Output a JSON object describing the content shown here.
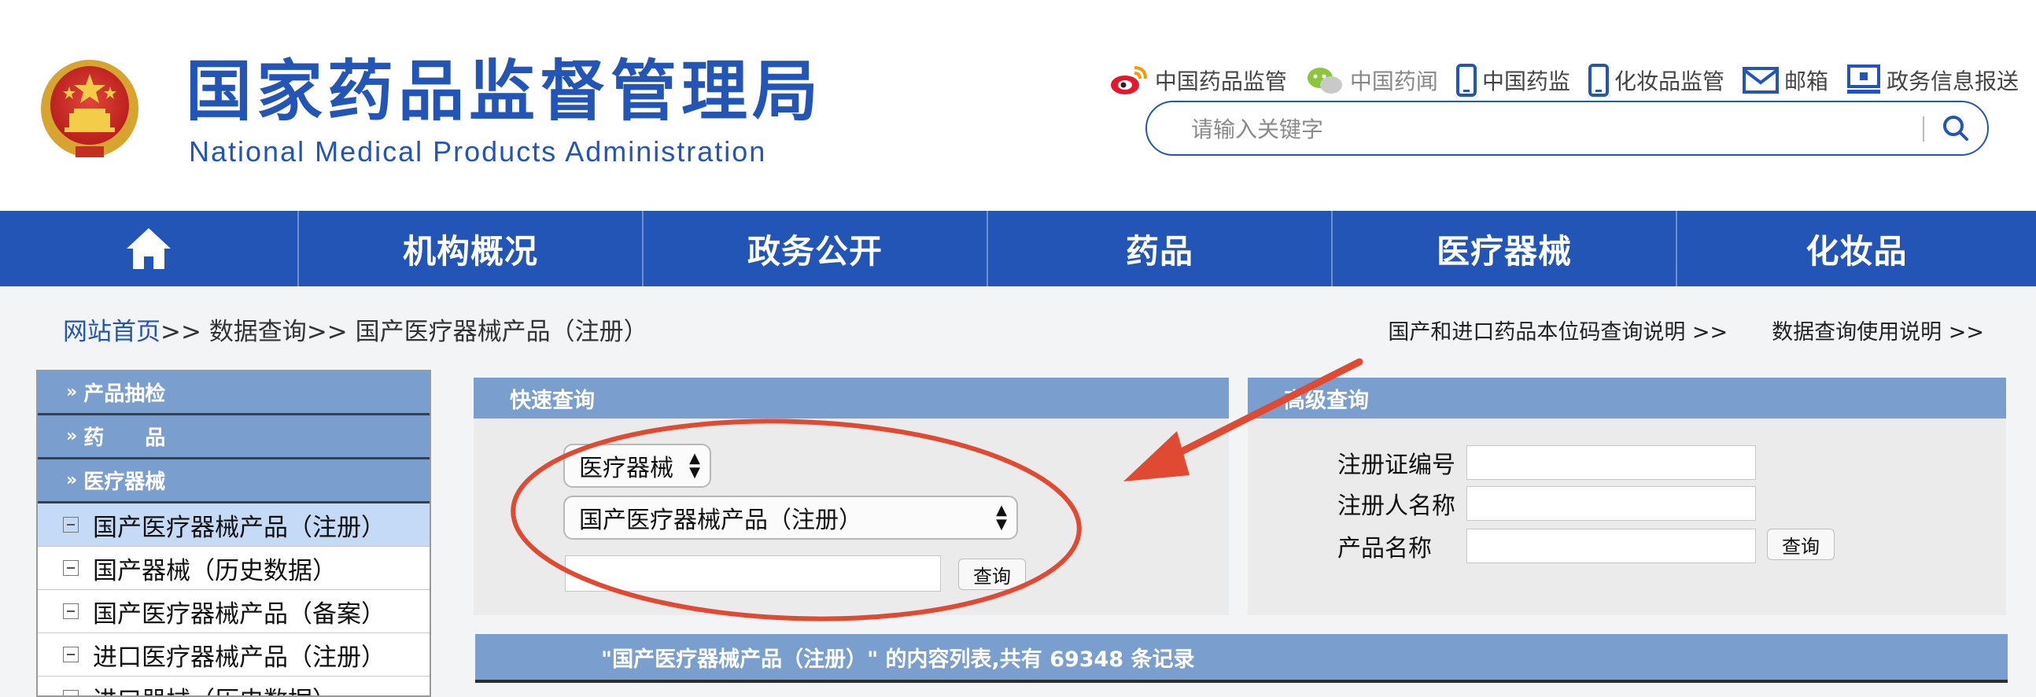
{
  "header": {
    "title_cn": "国家药品监督管理局",
    "title_en": "National Medical Products Administration",
    "top_links": [
      {
        "label": "中国药品监管",
        "icon": "weibo-icon"
      },
      {
        "label": "中国药闻",
        "icon": "wechat-icon"
      },
      {
        "label": "中国药监",
        "icon": "mobile-icon"
      },
      {
        "label": "化妆品监管",
        "icon": "mobile-icon"
      },
      {
        "label": "邮箱",
        "icon": "mail-icon"
      },
      {
        "label": "政务信息报送",
        "icon": "monitor-icon"
      }
    ],
    "search_placeholder": "请输入关键字"
  },
  "nav": {
    "home_icon": "home-icon",
    "items": [
      "机构概况",
      "政务公开",
      "药品",
      "医疗器械",
      "化妆品"
    ]
  },
  "breadcrumb": {
    "home": "网站首页",
    "sep1": ">> ",
    "level2": "数据查询",
    "sep2": ">> ",
    "current": "国产医疗器械产品（注册）"
  },
  "help_links": [
    "国产和进口药品本位码查询说明 >>",
    "数据查询使用说明 >>"
  ],
  "sidebar": {
    "categories": [
      "产品抽检",
      "药　　品",
      "医疗器械"
    ],
    "items": [
      {
        "label": "国产医疗器械产品（注册）",
        "active": true
      },
      {
        "label": "国产器械（历史数据）",
        "active": false
      },
      {
        "label": "国产医疗器械产品（备案）",
        "active": false
      },
      {
        "label": "进口医疗器械产品（注册）",
        "active": false
      },
      {
        "label": "进口器械（历史数据）",
        "active": false
      }
    ]
  },
  "quick_query": {
    "title": "快速查询",
    "category_value": "医疗器械",
    "product_value": "国产医疗器械产品（注册）",
    "input_value": "",
    "button": "查询"
  },
  "advanced_query": {
    "title": "高级查询",
    "fields": [
      "注册证编号",
      "注册人名称",
      "产品名称"
    ],
    "button": "查询"
  },
  "list": {
    "header": "\"国产医疗器械产品（注册）\" 的内容列表,共有 69348 条记录"
  },
  "colors": {
    "brand_blue": "#2355b6",
    "panel_blue": "#7a9fce",
    "annotation_red": "#e04a33"
  }
}
